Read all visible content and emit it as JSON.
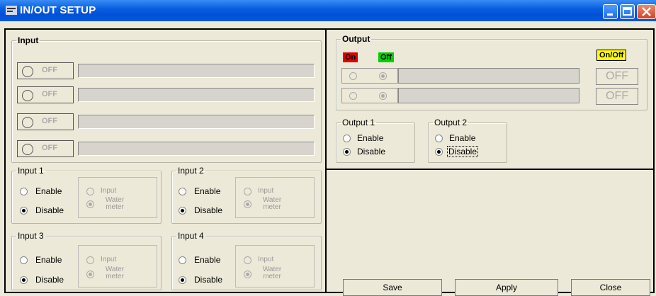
{
  "window": {
    "title": "IN/OUT SETUP"
  },
  "input": {
    "title": "Input",
    "leds": [
      {
        "state": "OFF"
      },
      {
        "state": "OFF"
      },
      {
        "state": "OFF"
      },
      {
        "state": "OFF"
      }
    ],
    "groups": [
      {
        "label": "Input 1",
        "enable": "Enable",
        "disable": "Disable",
        "selected": "Disable",
        "opt_input": "Input",
        "opt_water": "Water meter"
      },
      {
        "label": "Input 2",
        "enable": "Enable",
        "disable": "Disable",
        "selected": "Disable",
        "opt_input": "Input",
        "opt_water": "Water meter"
      },
      {
        "label": "Input 3",
        "enable": "Enable",
        "disable": "Disable",
        "selected": "Disable",
        "opt_input": "Input",
        "opt_water": "Water meter"
      },
      {
        "label": "Input 4",
        "enable": "Enable",
        "disable": "Disable",
        "selected": "Disable",
        "opt_input": "Input",
        "opt_water": "Water meter"
      }
    ]
  },
  "output": {
    "title": "Output",
    "on_label": "On",
    "off_label": "Off",
    "onoff_label": "On/Off",
    "rows": [
      {
        "button": "OFF"
      },
      {
        "button": "OFF"
      }
    ],
    "groups": [
      {
        "label": "Output 1",
        "enable": "Enable",
        "disable": "Disable",
        "selected": "Disable"
      },
      {
        "label": "Output 2",
        "enable": "Enable",
        "disable": "Disable",
        "selected": "Disable"
      }
    ]
  },
  "buttons": {
    "save": "Save",
    "apply": "Apply",
    "close": "Close"
  },
  "colors": {
    "title_bar": "#0050d8",
    "on_badge": "#e00000",
    "off_badge": "#00d000",
    "onoff_badge": "#ffff00"
  }
}
